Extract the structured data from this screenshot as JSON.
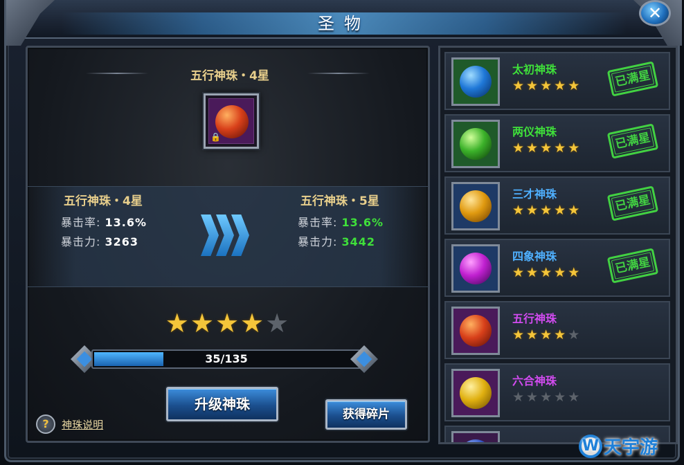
{
  "window": {
    "title": "圣物",
    "close_label": "✕"
  },
  "selected": {
    "name": "五行神珠・4星",
    "current": {
      "label": "五行神珠・4星",
      "crit_rate_label": "暴击率:",
      "crit_rate": "13.6%",
      "crit_dmg_label": "暴击力:",
      "crit_dmg": "3263"
    },
    "next": {
      "label": "五行神珠・5星",
      "crit_rate_label": "暴击率:",
      "crit_rate": "13.6%",
      "crit_dmg_label": "暴击力:",
      "crit_dmg": "3442"
    },
    "stars_filled": 4,
    "stars_total": 5,
    "orb_colors": [
      "#ffb060",
      "#d8401a",
      "#5a0e06"
    ],
    "frame_bg": "#4a1a5a"
  },
  "progress": {
    "text": "35/135",
    "current": 35,
    "total": 135
  },
  "buttons": {
    "upgrade": "升级神珠",
    "get_shards": "获得碎片"
  },
  "help": {
    "icon": "?",
    "label": "神珠说明"
  },
  "list": [
    {
      "name": "太初神珠",
      "name_color": "#3fe03a",
      "stars": 5,
      "full": true,
      "stamp": "已满星",
      "orb_colors": [
        "#9fdcff",
        "#1f78d8",
        "#062a5e"
      ],
      "frame_bg": "#1f5a2a"
    },
    {
      "name": "两仪神珠",
      "name_color": "#3fe03a",
      "stars": 5,
      "full": true,
      "stamp": "已满星",
      "orb_colors": [
        "#d0ff9a",
        "#3cb22a",
        "#0c3a08"
      ],
      "frame_bg": "#1f5a2a"
    },
    {
      "name": "三才神珠",
      "name_color": "#4fb0ff",
      "stars": 5,
      "full": true,
      "stamp": "已满星",
      "orb_colors": [
        "#ffe59a",
        "#e09a10",
        "#6a3a00"
      ],
      "frame_bg": "#1e3a66"
    },
    {
      "name": "四象神珠",
      "name_color": "#4fb0ff",
      "stars": 5,
      "full": true,
      "stamp": "已满星",
      "orb_colors": [
        "#ffa0ff",
        "#c020d0",
        "#3a0650"
      ],
      "frame_bg": "#1e3a66"
    },
    {
      "name": "五行神珠",
      "name_color": "#d24bf0",
      "stars": 4,
      "full": false,
      "stamp": "",
      "orb_colors": [
        "#ffb060",
        "#d8401a",
        "#5a0e06"
      ],
      "frame_bg": "#4a1a5a"
    },
    {
      "name": "六合神珠",
      "name_color": "#d24bf0",
      "stars": 0,
      "full": false,
      "stamp": "",
      "orb_colors": [
        "#fff0a0",
        "#e0b010",
        "#6a4a00"
      ],
      "frame_bg": "#4a1a5a"
    },
    {
      "name": "",
      "name_color": "#d24bf0",
      "stars": 0,
      "full": false,
      "stamp": "",
      "orb_colors": [
        "#a0c0ff",
        "#3050c0",
        "#101a50"
      ],
      "frame_bg": "#3a1a4a"
    }
  ],
  "star_glyph": "★",
  "colors": {
    "star_on": "#f4c53a",
    "star_off": "#5d636b",
    "stamp_green": "#42d142",
    "stat_up": "#3fe03a"
  },
  "watermark": {
    "icon": "W",
    "text": "天宇游"
  }
}
